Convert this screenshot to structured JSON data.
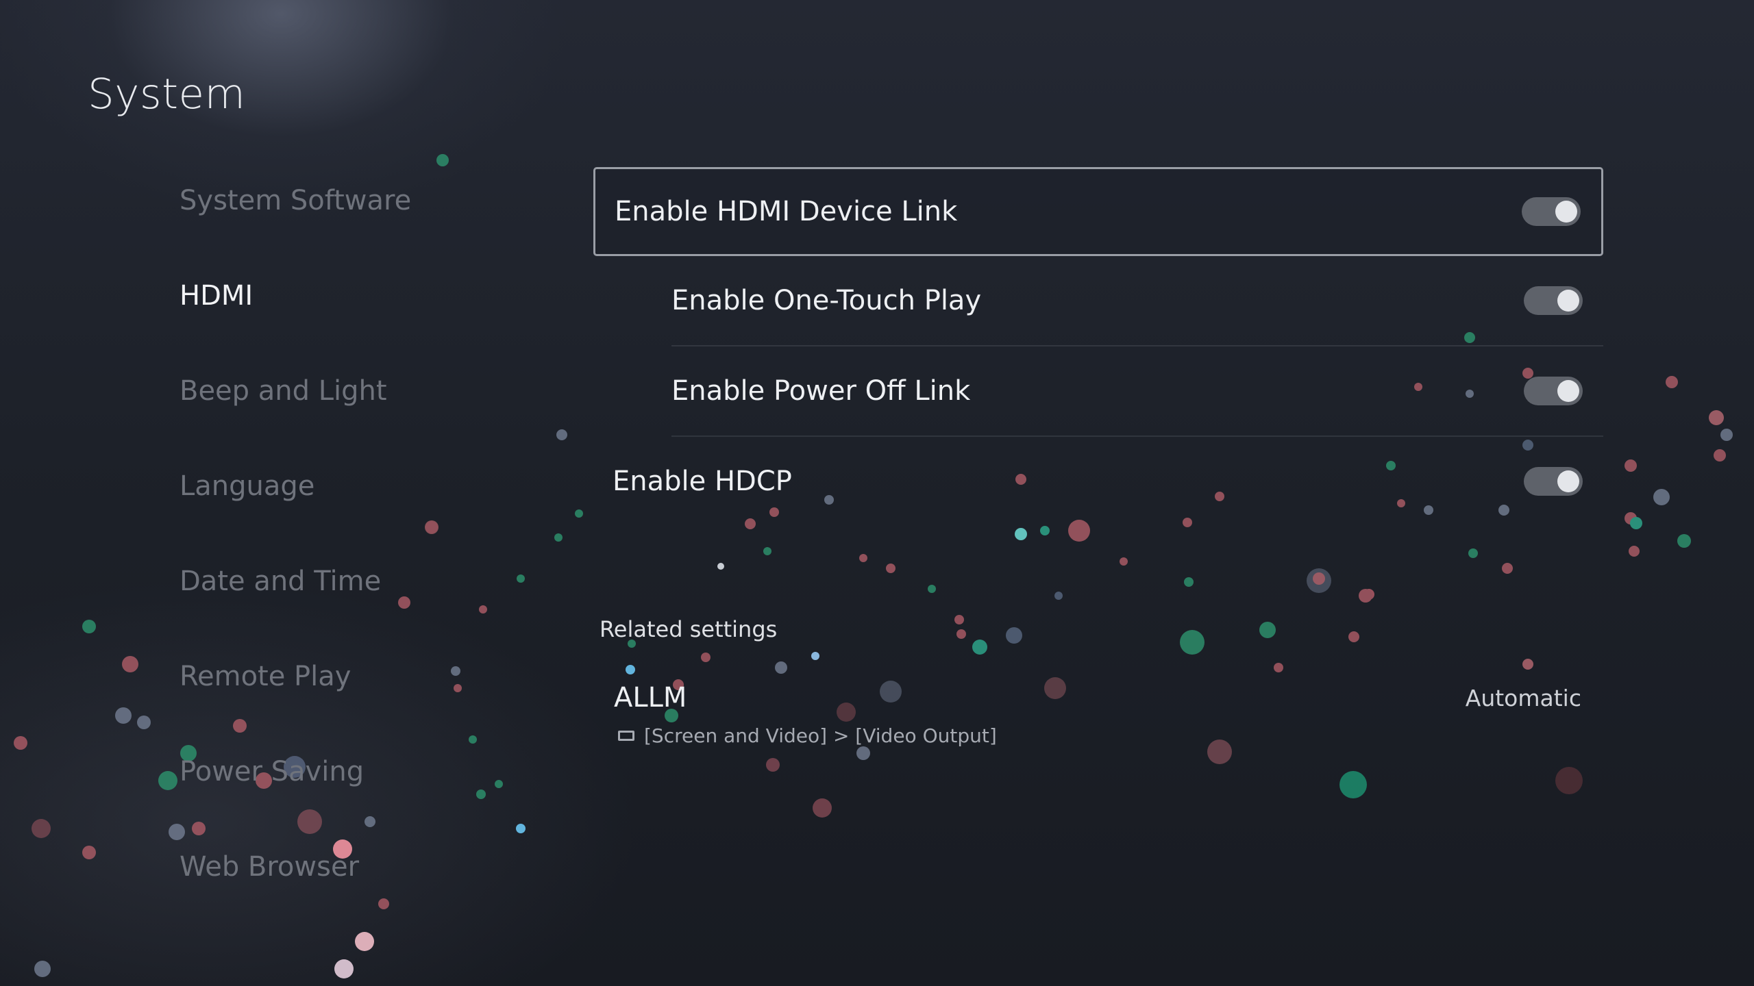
{
  "page": {
    "title": "System"
  },
  "sidebar": {
    "items": [
      {
        "label": "System Software",
        "active": false
      },
      {
        "label": "HDMI",
        "active": true
      },
      {
        "label": "Beep and Light",
        "active": false
      },
      {
        "label": "Language",
        "active": false
      },
      {
        "label": "Date and Time",
        "active": false
      },
      {
        "label": "Remote Play",
        "active": false
      },
      {
        "label": "Power Saving",
        "active": false
      },
      {
        "label": "Web Browser",
        "active": false
      }
    ]
  },
  "settings": {
    "hdmi_device_link": {
      "label": "Enable HDMI Device Link",
      "enabled": true
    },
    "one_touch_play": {
      "label": "Enable One-Touch Play",
      "enabled": true
    },
    "power_off_link": {
      "label": "Enable Power Off Link",
      "enabled": true
    },
    "hdcp": {
      "label": "Enable HDCP",
      "enabled": true
    }
  },
  "related": {
    "heading": "Related settings",
    "allm": {
      "label": "ALLM",
      "value": "Automatic",
      "path": "[Screen and Video] > [Video Output]",
      "path_icon": "screen-icon"
    }
  },
  "colors": {
    "background": "#1d2129",
    "toggle_track": "#5e626a",
    "toggle_knob": "#e4e6ea",
    "focus_border": "#9a9ea6"
  }
}
